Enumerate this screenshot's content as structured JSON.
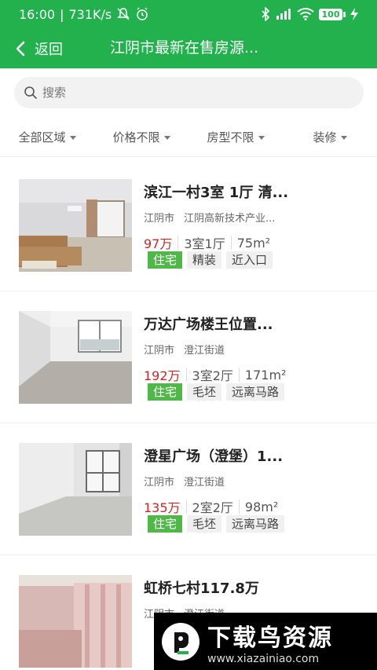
{
  "status": {
    "time": "16:00",
    "speed": "731K/s",
    "battery": "100"
  },
  "header": {
    "back_label": "返回",
    "title": "江阴市最新在售房源..."
  },
  "search": {
    "placeholder": "搜索"
  },
  "filters": [
    "全部区域",
    "价格不限",
    "房型不限",
    "装修"
  ],
  "listings": [
    {
      "title": "滨江一村3室 1厅 清...",
      "city": "江阴市",
      "area": "江阴高新技术产业...",
      "price": "97万",
      "rooms": "3室1厅",
      "size": "75m²",
      "tags": [
        "住宅",
        "精装",
        "近入口"
      ]
    },
    {
      "title": "万达广场楼王位置...",
      "city": "江阴市",
      "area": "澄江街道",
      "price": "192万",
      "rooms": "3室2厅",
      "size": "171m²",
      "tags": [
        "住宅",
        "毛坯",
        "远离马路"
      ]
    },
    {
      "title": "澄星广场（澄堡）1...",
      "city": "江阴市",
      "area": "澄江街道",
      "price": "135万",
      "rooms": "2室2厅",
      "size": "98m²",
      "tags": [
        "住宅",
        "毛坯",
        "远离马路"
      ]
    },
    {
      "title": "虹桥七村117.8万",
      "city": "江阴市",
      "area": "澄江街道",
      "price": "",
      "rooms": "",
      "size": "",
      "tags": []
    }
  ],
  "promo": {
    "title": "下载鸟资源",
    "url": "www.xiazainiao.com"
  },
  "colors": {
    "brand_green": "#22b14c",
    "price_red": "#c62828",
    "tag_green": "#4fb848"
  }
}
